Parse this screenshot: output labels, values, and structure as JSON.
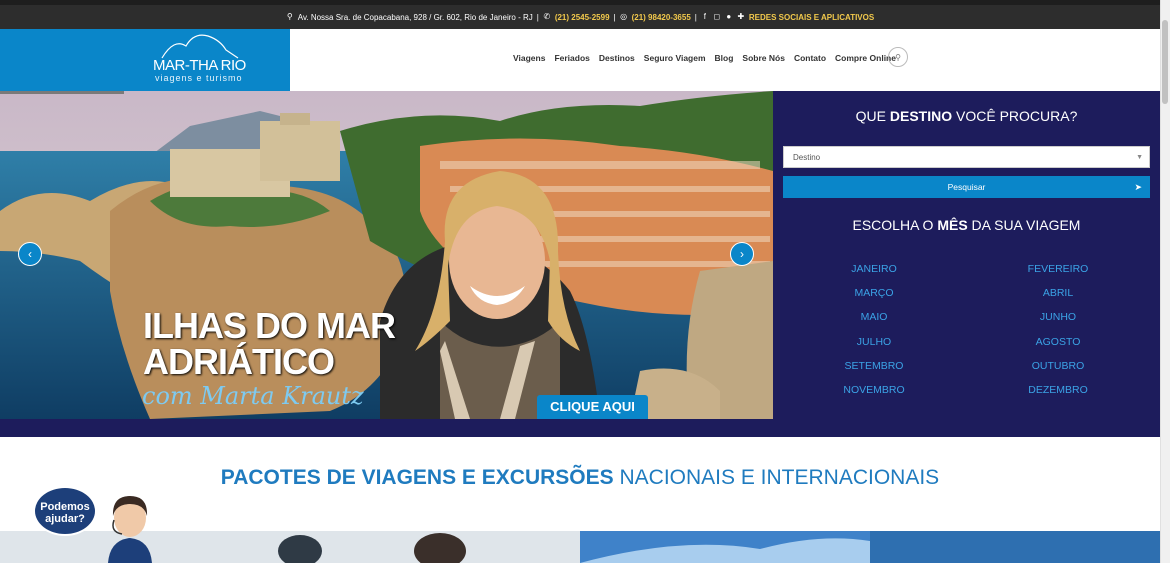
{
  "topbar": {
    "address": "Av. Nossa Sra. de Copacabana, 928 / Gr. 602, Rio de Janeiro - RJ",
    "phone1": "(21) 2545-2599",
    "phone2": "(21) 98420-3655",
    "social_label": "REDES SOCIAIS E APLICATIVOS"
  },
  "logo": {
    "name": "MAR-THA RIO",
    "tagline": "viagens e turismo"
  },
  "nav": {
    "items": [
      "Viagens",
      "Feriados",
      "Destinos",
      "Seguro Viagem",
      "Blog",
      "Sobre Nós",
      "Contato",
      "Compre Online"
    ]
  },
  "hero": {
    "title_line1": "ILHAS DO MAR",
    "title_line2": "ADRIÁTICO",
    "subtitle": "com Marta Krautz",
    "cta": "CLIQUE AQUI"
  },
  "search_panel": {
    "title_pre": "QUE ",
    "title_bold": "DESTINO",
    "title_post": " VOCÊ PROCURA?",
    "destination_value": "Destino",
    "search_button": "Pesquisar",
    "month_title_pre": "ESCOLHA O ",
    "month_title_bold": "MÊS",
    "month_title_post": " DA SUA VIAGEM",
    "months": [
      "JANEIRO",
      "FEVEREIRO",
      "MARÇO",
      "ABRIL",
      "MAIO",
      "JUNHO",
      "JULHO",
      "AGOSTO",
      "SETEMBRO",
      "OUTUBRO",
      "NOVEMBRO",
      "DEZEMBRO"
    ]
  },
  "section": {
    "headline_bold": "PACOTES DE VIAGENS E EXCURSÕES",
    "headline_rest": " NACIONAIS E INTERNACIONAIS"
  },
  "chat": {
    "line1": "Podemos",
    "line2": "ajudar?"
  },
  "colors": {
    "brand_blue": "#0a86c9",
    "panel_navy": "#1d1c5c",
    "month_blue": "#3ba3e6",
    "topbar": "#2d2d2d"
  }
}
